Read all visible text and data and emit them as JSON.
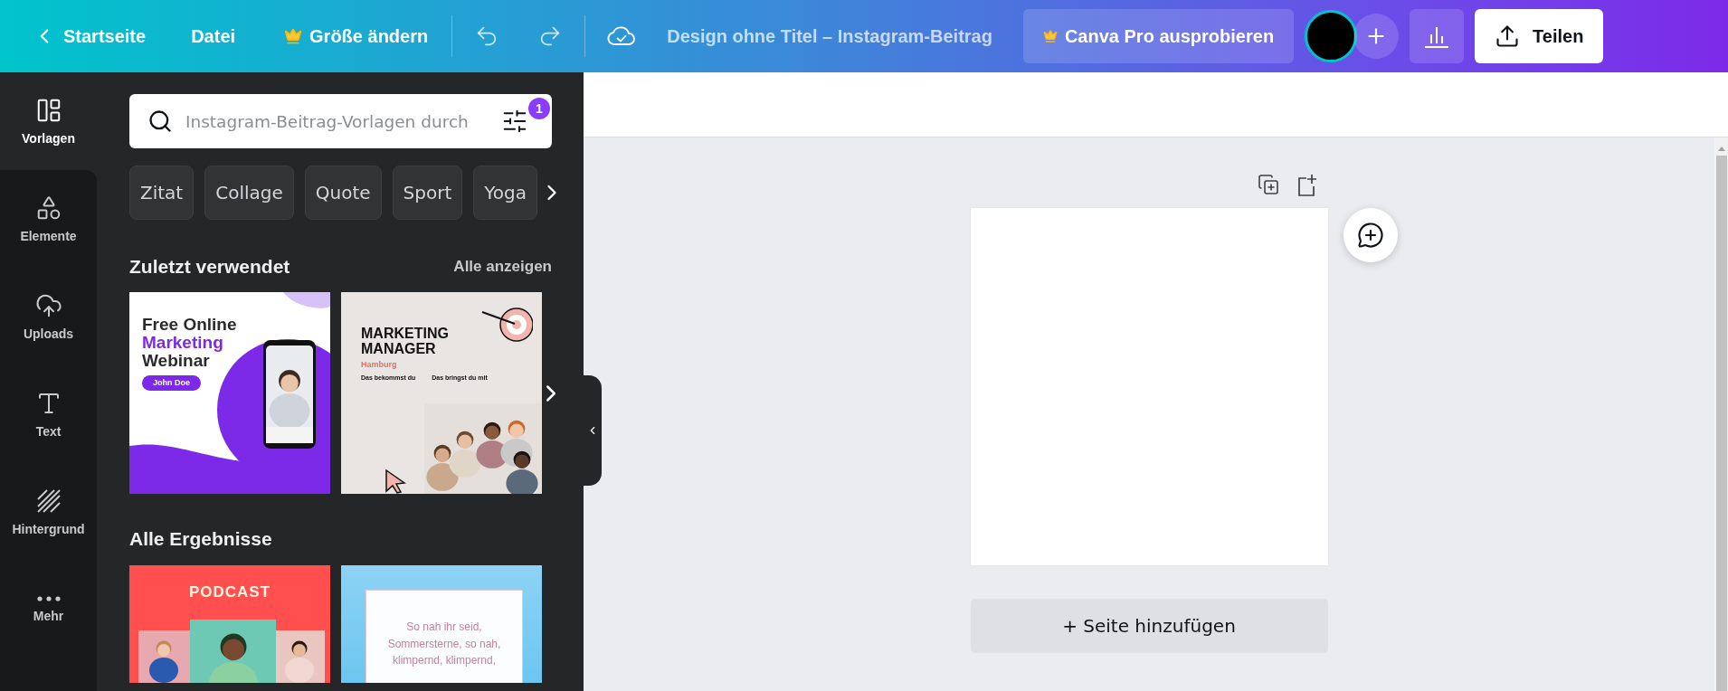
{
  "topbar": {
    "back": "Startseite",
    "menu": "Datei",
    "resize": "Größe ändern",
    "title": "Design ohne Titel – Instagram-Beitrag",
    "pro_button": "Canva Pro ausprobieren",
    "share": "Teilen"
  },
  "rail": [
    {
      "kind": "templates",
      "label": "Vorlagen",
      "selected": true
    },
    {
      "kind": "elements",
      "label": "Elemente",
      "selected": false
    },
    {
      "kind": "uploads",
      "label": "Uploads",
      "selected": false
    },
    {
      "kind": "text",
      "label": "Text",
      "selected": false
    },
    {
      "kind": "background",
      "label": "Hintergrund",
      "selected": false
    },
    {
      "kind": "more",
      "label": "Mehr",
      "selected": false
    }
  ],
  "search": {
    "placeholder": "Instagram-Beitrag-Vorlagen durch",
    "filter_count": "1"
  },
  "chips": [
    "Zitat",
    "Collage",
    "Quote",
    "Sport",
    "Yoga"
  ],
  "recent": {
    "title": "Zuletzt verwendet",
    "link": "Alle anzeigen",
    "templates": [
      {
        "kind": "webinar",
        "heading": [
          "Free Online",
          "Marketing",
          "Webinar"
        ],
        "button": "John Doe"
      },
      {
        "kind": "job",
        "title": [
          "MARKETING",
          "MANAGER"
        ],
        "city": "Hamburg",
        "columns": [
          "Das bekommst du",
          "Das bringst du mit"
        ]
      }
    ]
  },
  "results": {
    "title": "Alle Ergebnisse",
    "templates": [
      {
        "kind": "podcast",
        "title": "PODCAST"
      },
      {
        "kind": "poem",
        "lines": [
          "So nah ihr seid,",
          "Sommersterne, so nah,",
          "klimpernd, klimpernd,"
        ]
      }
    ]
  },
  "canvas": {
    "add_page": "+ Seite hinzufügen"
  }
}
